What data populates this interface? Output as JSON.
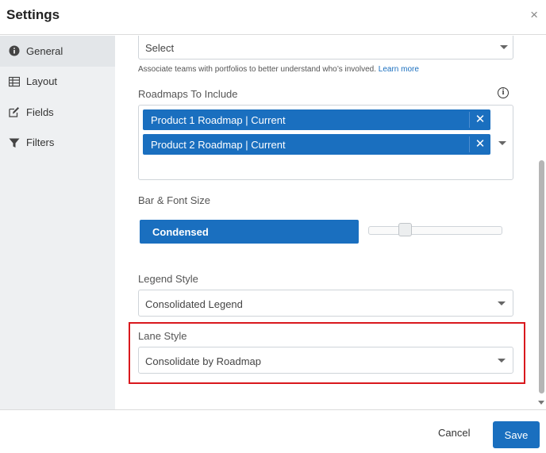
{
  "dialog": {
    "title": "Settings",
    "close_glyph": "×"
  },
  "sidebar": {
    "items": [
      {
        "label": "General",
        "icon": "info-circle-icon",
        "active": true
      },
      {
        "label": "Layout",
        "icon": "table-grid-icon",
        "active": false
      },
      {
        "label": "Fields",
        "icon": "edit-icon",
        "active": false
      },
      {
        "label": "Filters",
        "icon": "funnel-icon",
        "active": false
      }
    ]
  },
  "teams": {
    "select_value": "Select",
    "helper_text": "Associate teams with portfolios to better understand who’s involved.",
    "helper_link": "Learn more"
  },
  "roadmaps": {
    "label": "Roadmaps To Include",
    "info_glyph": "i",
    "chips": [
      {
        "label": "Product 1 Roadmap | Current",
        "remove_glyph": "✕"
      },
      {
        "label": "Product 2 Roadmap | Current",
        "remove_glyph": "✕"
      }
    ]
  },
  "bar_font": {
    "label": "Bar & Font Size",
    "button_label": "Condensed",
    "slider_value": 0.25
  },
  "legend": {
    "label": "Legend Style",
    "value": "Consolidated Legend"
  },
  "lane": {
    "label": "Lane Style",
    "value": "Consolidate by Roadmap"
  },
  "footer": {
    "cancel_label": "Cancel",
    "save_label": "Save"
  },
  "colors": {
    "accent": "#1a6fbf",
    "highlight": "#d9181d",
    "sidebar_bg": "#eef0f2"
  }
}
